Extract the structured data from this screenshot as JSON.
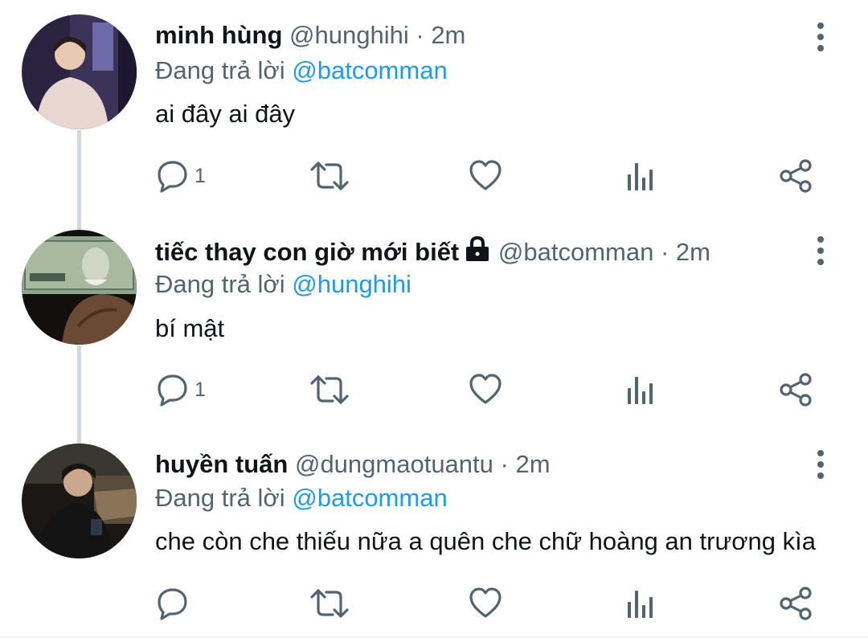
{
  "tweets": [
    {
      "name": "minh hùng",
      "handle": "@hunghihi",
      "time": "2m",
      "replying_label": "Đang trả lời",
      "replying_to": "@batcomman",
      "text": "ai đây ai đây",
      "reply_count": "1",
      "protected": false
    },
    {
      "name": "tiếc thay con giờ mới biết",
      "handle": "@batcomman",
      "time": "2m",
      "replying_label": "Đang trả lời",
      "replying_to": "@hunghihi",
      "text": "bí mật",
      "reply_count": "1",
      "protected": true
    },
    {
      "name": "huyền tuấn",
      "handle": "@dungmaotuantu",
      "time": "2m",
      "replying_label": "Đang trả lời",
      "replying_to": "@batcomman",
      "text": "che còn che thiếu nữa a quên che chữ hoàng an trương kìa",
      "reply_count": "",
      "protected": false
    }
  ],
  "separator": "·",
  "colors": {
    "text": "#0f1419",
    "secondary": "#536471",
    "accent": "#1d9bf0",
    "thread_line": "#cfd9de"
  },
  "icons": {
    "more": "more-vertical-icon",
    "reply": "reply-icon",
    "retweet": "retweet-icon",
    "like": "heart-icon",
    "analytics": "analytics-icon",
    "share": "share-icon",
    "protected": "lock-icon"
  }
}
